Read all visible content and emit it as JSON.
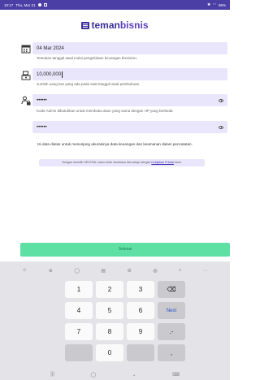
{
  "status_bar": {
    "time": "10:17",
    "date": "Thu, Mar 21",
    "battery": "96%"
  },
  "logo": {
    "prefix": "teman",
    "suffix": "bisnis"
  },
  "form": {
    "start_date": {
      "value": "04 Mar 2024",
      "hint": "Tentukan tanggal awal mulai pengelolaan keuangan bisnismu."
    },
    "cash": {
      "value": "10,000,000",
      "hint": "Jumlah uang kas yang ada pada saat tanggal awal pembukuan."
    },
    "admin_code": {
      "value": "••••••",
      "hint": "Kode Admin dibutuhkan untuk membuka akun yang sama dengan HP yang berbeda"
    },
    "admin_code_confirm": {
      "value": "••••••"
    }
  },
  "info_text": "Isi data diatas untuk menunjang akurasinya data keuangan dan keamanan dalam pencatatan.",
  "agreement": {
    "text": "Dengan memilih SELESAI, kamu telah membaca dan setuju dengan",
    "link": "Kebijakan Privasi",
    "suffix": "kami."
  },
  "submit_label": "Selesai",
  "keyboard": {
    "toolbar": [
      "☺",
      "⊕",
      "◯",
      "▤",
      "⚙",
      "◍",
      "⌕",
      "⋯"
    ],
    "keys": [
      "1",
      "2",
      "3",
      "⌫",
      "4",
      "5",
      "6",
      "Next",
      "7",
      "8",
      "9",
      ".-",
      "0",
      ","
    ]
  },
  "navbar": [
    "|||",
    "◯",
    "⌄",
    "⌨"
  ]
}
